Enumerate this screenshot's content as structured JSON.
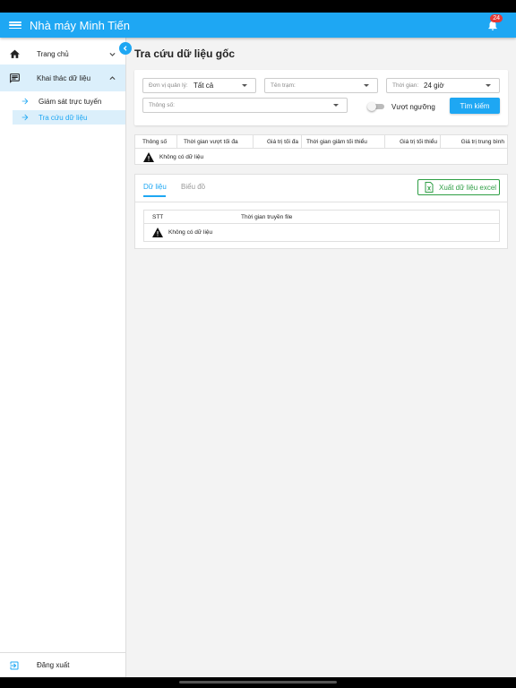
{
  "app": {
    "title": "Nhà máy Minh Tiến",
    "notification_count": "24"
  },
  "sidebar": {
    "items": [
      {
        "label": "Trang chủ",
        "icon": "home-icon"
      },
      {
        "label": "Khai thác dữ liệu",
        "icon": "list-icon"
      }
    ],
    "sub_items": [
      {
        "label": "Giám sát trực tuyến",
        "icon": "arrow-right-icon"
      },
      {
        "label": "Tra cứu dữ liệu",
        "icon": "arrow-right-icon",
        "active": true
      }
    ],
    "logout_label": "Đăng xuất"
  },
  "page": {
    "title": "Tra cứu dữ liệu gốc"
  },
  "filters": {
    "don_vi": {
      "label": "Đơn vị quản lý:",
      "value": "Tất cả"
    },
    "ten_tram": {
      "label": "Tên trạm:"
    },
    "thoi_gian": {
      "label": "Thời gian:",
      "value": "24 giờ"
    },
    "thong_so": {
      "label": "Thông số:"
    },
    "threshold_toggle_label": "Vượt ngưỡng",
    "search_label": "Tìm kiếm"
  },
  "stats_table": {
    "headers": [
      "Thông số",
      "Thời gian vượt tối đa",
      "Giá trị tối đa",
      "Thời gian giảm tối thiểu",
      "Giá trị tối thiểu",
      "Giá trị trung bình"
    ],
    "empty_message": "Không có dữ liệu"
  },
  "data_panel": {
    "tabs": [
      "Dữ liệu",
      "Biểu đồ"
    ],
    "export_label": "Xuất dữ liệu excel",
    "table_headers": [
      "STT",
      "Thời gian truyền file"
    ],
    "empty_message": "Không có dữ liệu"
  },
  "colors": {
    "primary": "#1ea7f3",
    "excel_green": "#2e9e44",
    "badge_red": "#e53935"
  }
}
